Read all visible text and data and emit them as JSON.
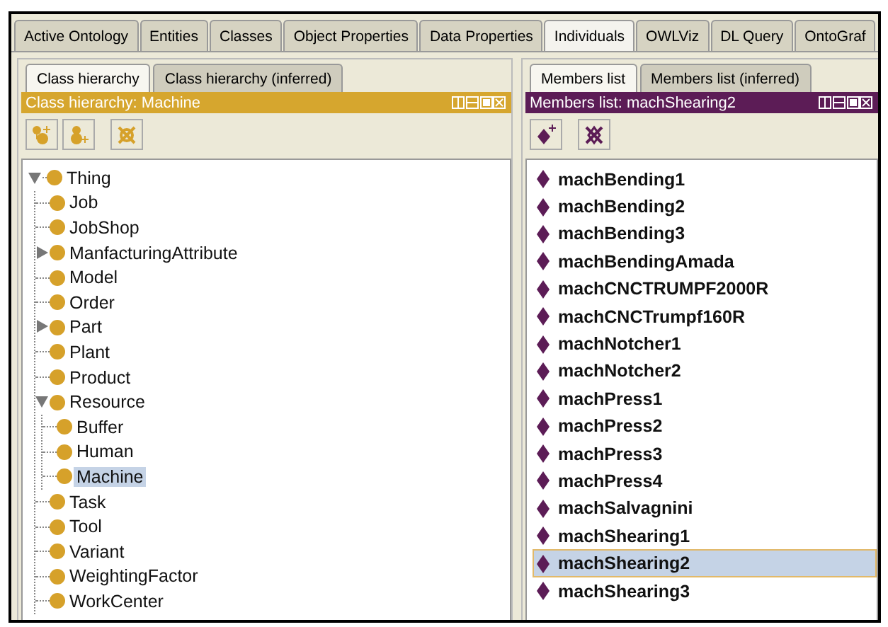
{
  "tabs": [
    {
      "label": "Active Ontology",
      "selected": false
    },
    {
      "label": "Entities",
      "selected": false
    },
    {
      "label": "Classes",
      "selected": false
    },
    {
      "label": "Object Properties",
      "selected": false
    },
    {
      "label": "Data Properties",
      "selected": false
    },
    {
      "label": "Individuals",
      "selected": true
    },
    {
      "label": "OWLViz",
      "selected": false
    },
    {
      "label": "DL Query",
      "selected": false
    },
    {
      "label": "OntoGraf",
      "selected": false
    }
  ],
  "left_panel": {
    "subtabs": [
      {
        "label": "Class hierarchy",
        "selected": true
      },
      {
        "label": "Class hierarchy (inferred)",
        "selected": false
      }
    ],
    "header": "Class hierarchy: Machine",
    "tree": [
      {
        "label": "Thing",
        "expanded": true,
        "selected": false,
        "children": [
          {
            "label": "Job",
            "selected": false
          },
          {
            "label": "JobShop",
            "selected": false
          },
          {
            "label": "ManfacturingAttribute",
            "expanded": false,
            "selected": false
          },
          {
            "label": "Model",
            "selected": false
          },
          {
            "label": "Order",
            "selected": false
          },
          {
            "label": "Part",
            "expanded": false,
            "selected": false
          },
          {
            "label": "Plant",
            "selected": false
          },
          {
            "label": "Product",
            "selected": false
          },
          {
            "label": "Resource",
            "expanded": true,
            "selected": false,
            "children": [
              {
                "label": "Buffer",
                "selected": false
              },
              {
                "label": "Human",
                "selected": false
              },
              {
                "label": "Machine",
                "selected": true
              }
            ]
          },
          {
            "label": "Task",
            "selected": false
          },
          {
            "label": "Tool",
            "selected": false
          },
          {
            "label": "Variant",
            "selected": false
          },
          {
            "label": "WeightingFactor",
            "selected": false
          },
          {
            "label": "WorkCenter",
            "selected": false
          }
        ]
      }
    ]
  },
  "right_panel": {
    "subtabs": [
      {
        "label": "Members list",
        "selected": true
      },
      {
        "label": "Members list (inferred)",
        "selected": false
      }
    ],
    "header": "Members list: machShearing2",
    "members": [
      {
        "label": "machBending1",
        "selected": false
      },
      {
        "label": "machBending2",
        "selected": false
      },
      {
        "label": "machBending3",
        "selected": false
      },
      {
        "label": "machBendingAmada",
        "selected": false
      },
      {
        "label": "machCNCTRUMPF2000R",
        "selected": false
      },
      {
        "label": "machCNCTrumpf160R",
        "selected": false
      },
      {
        "label": "machNotcher1",
        "selected": false
      },
      {
        "label": "machNotcher2",
        "selected": false
      },
      {
        "label": "machPress1",
        "selected": false
      },
      {
        "label": "machPress2",
        "selected": false
      },
      {
        "label": "machPress3",
        "selected": false
      },
      {
        "label": "machPress4",
        "selected": false
      },
      {
        "label": "machSalvagnini",
        "selected": false
      },
      {
        "label": "machShearing1",
        "selected": false
      },
      {
        "label": "machShearing2",
        "selected": true
      },
      {
        "label": "machShearing3",
        "selected": false
      }
    ]
  }
}
